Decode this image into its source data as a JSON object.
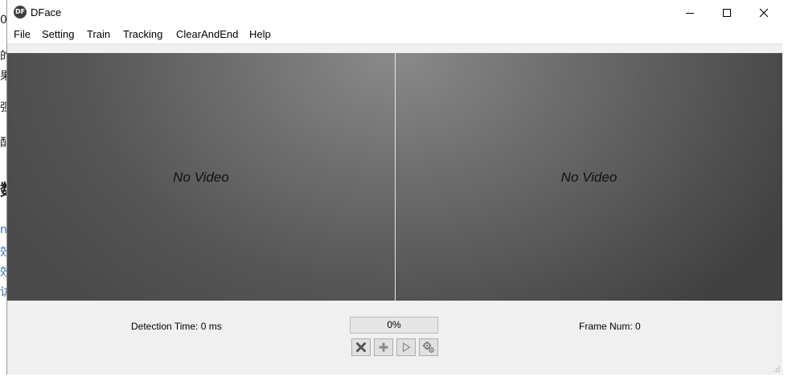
{
  "background_fragments": [
    "0",
    "的",
    "果",
    "强",
    "配",
    "数",
    "n(",
    "效",
    "效",
    "访"
  ],
  "window": {
    "title": "DFace",
    "app_icon": "dface-logo-icon",
    "controls": [
      "minimize-icon",
      "maximize-icon",
      "close-icon"
    ]
  },
  "menu": {
    "items": [
      "File",
      "Setting",
      "Train",
      "Tracking",
      "ClearAndEnd",
      "Help"
    ]
  },
  "video": {
    "left_placeholder": "No Video",
    "right_placeholder": "No Video"
  },
  "status": {
    "detection_time": "Detection Time: 0 ms",
    "progress_text": "0%",
    "progress_value": 0,
    "frame_num": "Frame Num: 0"
  },
  "toolbar": {
    "buttons": [
      "stop-x-icon",
      "add-plus-icon",
      "play-icon",
      "settings-gears-icon"
    ]
  }
}
